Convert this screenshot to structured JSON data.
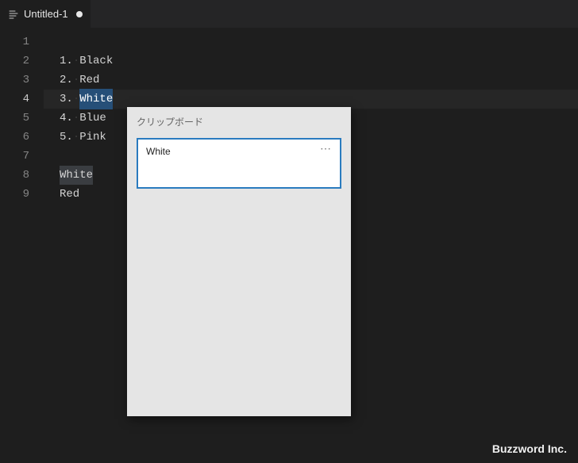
{
  "tab": {
    "title": "Untitled-1"
  },
  "editor": {
    "lines": [
      {
        "n": 1,
        "prefix": "",
        "text": "",
        "sel": false,
        "wh": false
      },
      {
        "n": 2,
        "prefix": "1.",
        "text": "Black",
        "sel": false,
        "wh": false
      },
      {
        "n": 3,
        "prefix": "2.",
        "text": "Red",
        "sel": false,
        "wh": false
      },
      {
        "n": 4,
        "prefix": "3.",
        "text": "White",
        "sel": true,
        "wh": false,
        "current": true
      },
      {
        "n": 5,
        "prefix": "4.",
        "text": "Blue",
        "sel": false,
        "wh": false
      },
      {
        "n": 6,
        "prefix": "5.",
        "text": "Pink",
        "sel": false,
        "wh": false
      },
      {
        "n": 7,
        "prefix": "",
        "text": "",
        "sel": false,
        "wh": false
      },
      {
        "n": 8,
        "prefix": "",
        "text": "White",
        "sel": false,
        "wh": true
      },
      {
        "n": 9,
        "prefix": "",
        "text": "Red",
        "sel": false,
        "wh": false
      }
    ]
  },
  "clipboard": {
    "title": "クリップボード",
    "items": [
      {
        "text": "White"
      }
    ]
  },
  "watermark": "Buzzword Inc."
}
